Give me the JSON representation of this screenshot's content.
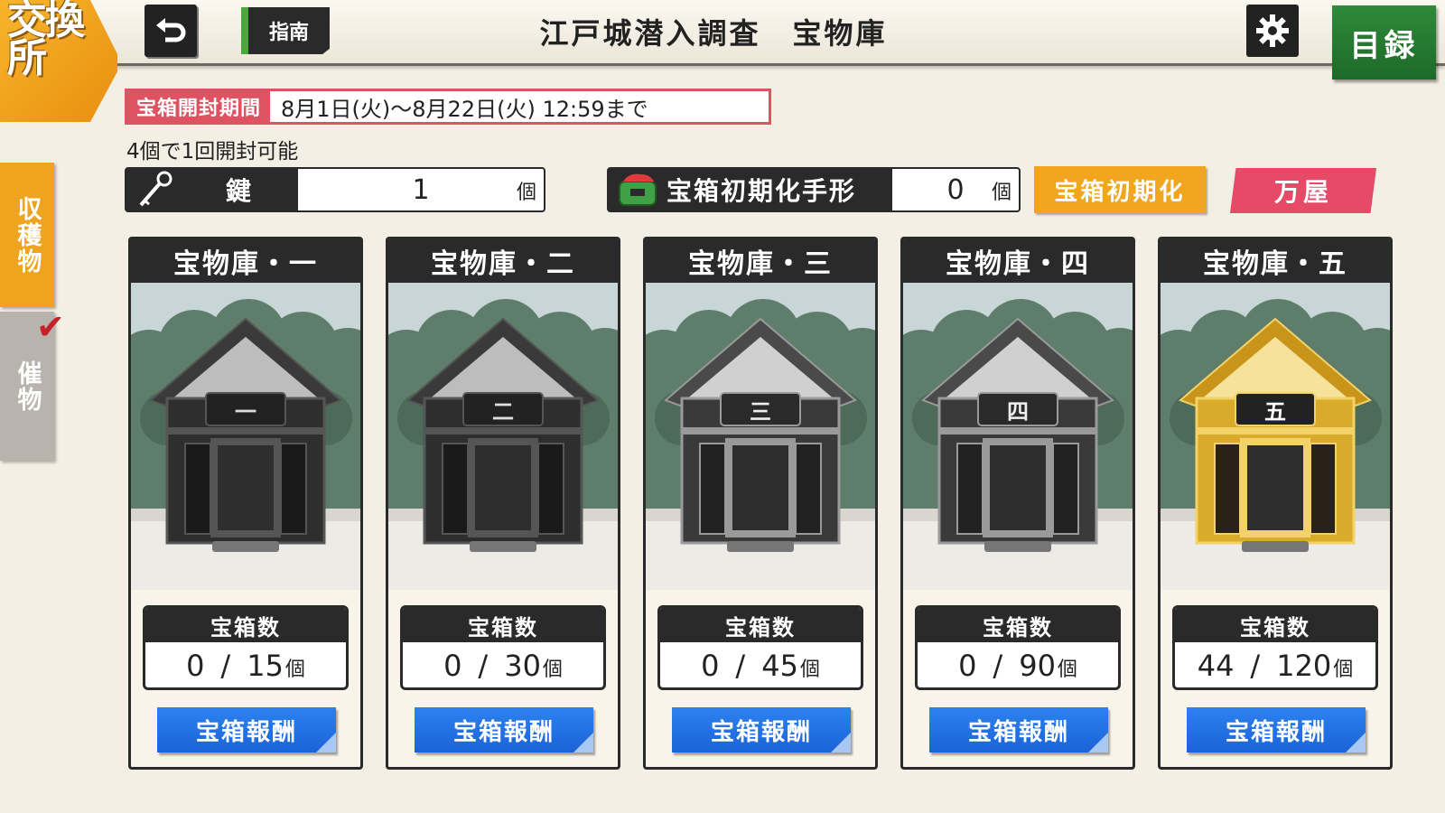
{
  "header": {
    "brand": "交換所",
    "guide_label": "指南",
    "title": "江戸城潜入調査　宝物庫",
    "catalog_label": "目録"
  },
  "side_tabs": {
    "harvest": "収穫物",
    "event": "催物"
  },
  "period": {
    "label": "宝箱開封期間",
    "value": "8月1日(火)〜8月22日(火) 12:59まで"
  },
  "open_note": "4個で1回開封可能",
  "keys": {
    "label": "鍵",
    "count": "1",
    "unit": "個"
  },
  "reset_tickets": {
    "label": "宝箱初期化手形",
    "count": "0",
    "unit": "個"
  },
  "buttons": {
    "reset": "宝箱初期化",
    "shop": "万屋"
  },
  "vaults": [
    {
      "title": "宝物庫・一",
      "plaque": "一",
      "count_label": "宝箱数",
      "opened": "0",
      "total": "15",
      "unit": "個",
      "reward_label": "宝箱報酬",
      "style": "black"
    },
    {
      "title": "宝物庫・二",
      "plaque": "二",
      "count_label": "宝箱数",
      "opened": "0",
      "total": "30",
      "unit": "個",
      "reward_label": "宝箱報酬",
      "style": "black"
    },
    {
      "title": "宝物庫・三",
      "plaque": "三",
      "count_label": "宝箱数",
      "opened": "0",
      "total": "45",
      "unit": "個",
      "reward_label": "宝箱報酬",
      "style": "silver"
    },
    {
      "title": "宝物庫・四",
      "plaque": "四",
      "count_label": "宝箱数",
      "opened": "0",
      "total": "90",
      "unit": "個",
      "reward_label": "宝箱報酬",
      "style": "silver"
    },
    {
      "title": "宝物庫・五",
      "plaque": "五",
      "count_label": "宝箱数",
      "opened": "44",
      "total": "120",
      "unit": "個",
      "reward_label": "宝箱報酬",
      "style": "gold"
    }
  ],
  "colors": {
    "accent_orange": "#efa41f",
    "period_red": "#de5262",
    "reward_blue": "#1a63d6",
    "catalog_green": "#1d6a28",
    "shop_pink": "#e64a66",
    "gold": "#d4a81e"
  }
}
